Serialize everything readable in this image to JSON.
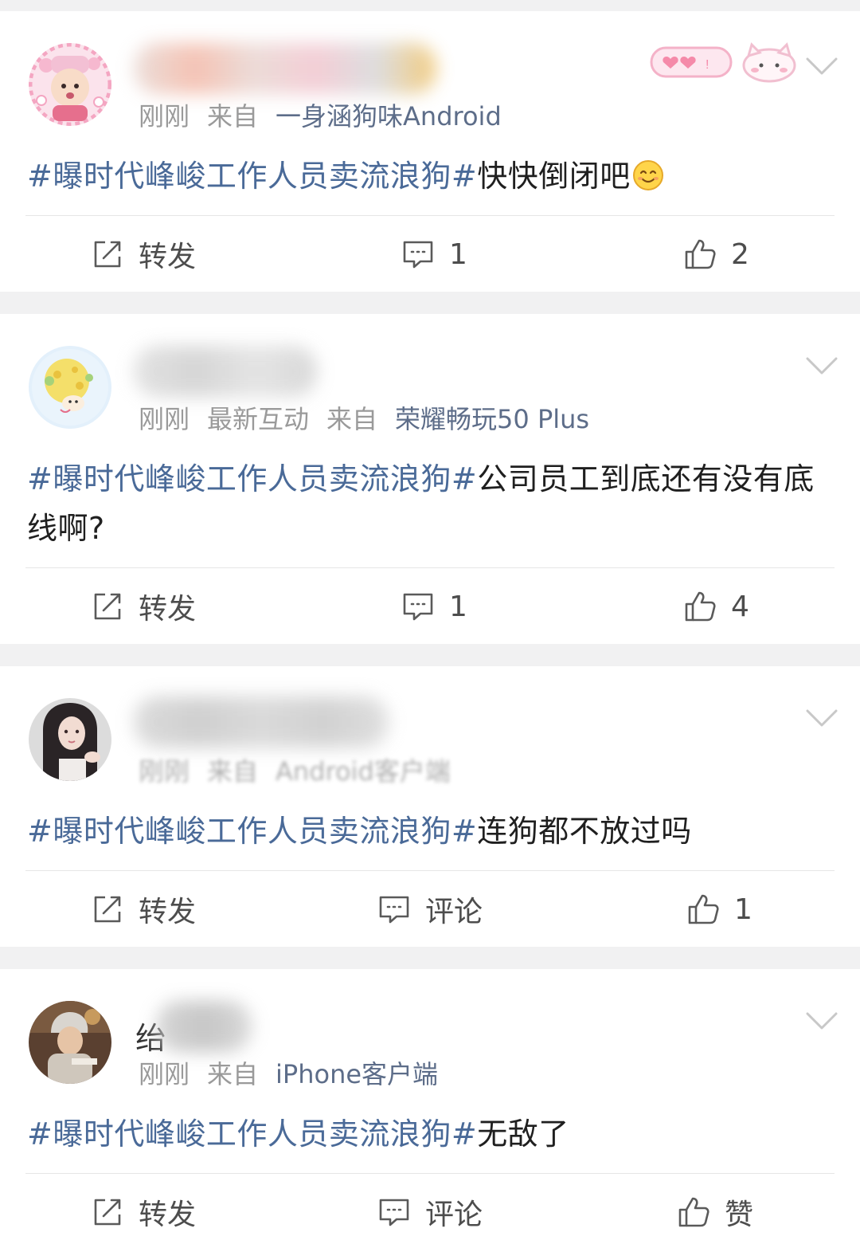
{
  "labels": {
    "repost": "转发",
    "comment": "评论",
    "like": "赞",
    "from": "来自"
  },
  "posts": [
    {
      "time": "刚刚",
      "interaction": "",
      "source": "一身涵狗味Android",
      "hashtag": "#曝时代峰峻工作人员卖流浪狗#",
      "text": "快快倒闭吧",
      "comment_display": "1",
      "like_display": "2"
    },
    {
      "time": "刚刚",
      "interaction": "最新互动",
      "source": "荣耀畅玩50 Plus",
      "hashtag": "#曝时代峰峻工作人员卖流浪狗#",
      "text": "公司员工到底还有没有底线啊?",
      "comment_display": "1",
      "like_display": "4"
    },
    {
      "time": "刚刚",
      "interaction": "",
      "source": "Android客户端",
      "hashtag": "#曝时代峰峻工作人员卖流浪狗#",
      "text": "连狗都不放过吗",
      "comment_display": "评论",
      "like_display": "1"
    },
    {
      "time": "刚刚",
      "interaction": "",
      "name_initial": "绐",
      "source": "iPhone客户端",
      "hashtag": "#曝时代峰峻工作人员卖流浪狗#",
      "text": "无敌了",
      "comment_display": "评论",
      "like_display": "赞"
    }
  ],
  "icons": {
    "repost": "repost-edit-icon",
    "comment": "comment-bubble-icon",
    "like": "thumbs-up-icon",
    "more": "chevron-down-icon"
  },
  "colors": {
    "hashtag": "#4a6a98",
    "source": "#5d6d89",
    "meta": "#9a9a9a",
    "separator": "#f1f1f2"
  }
}
